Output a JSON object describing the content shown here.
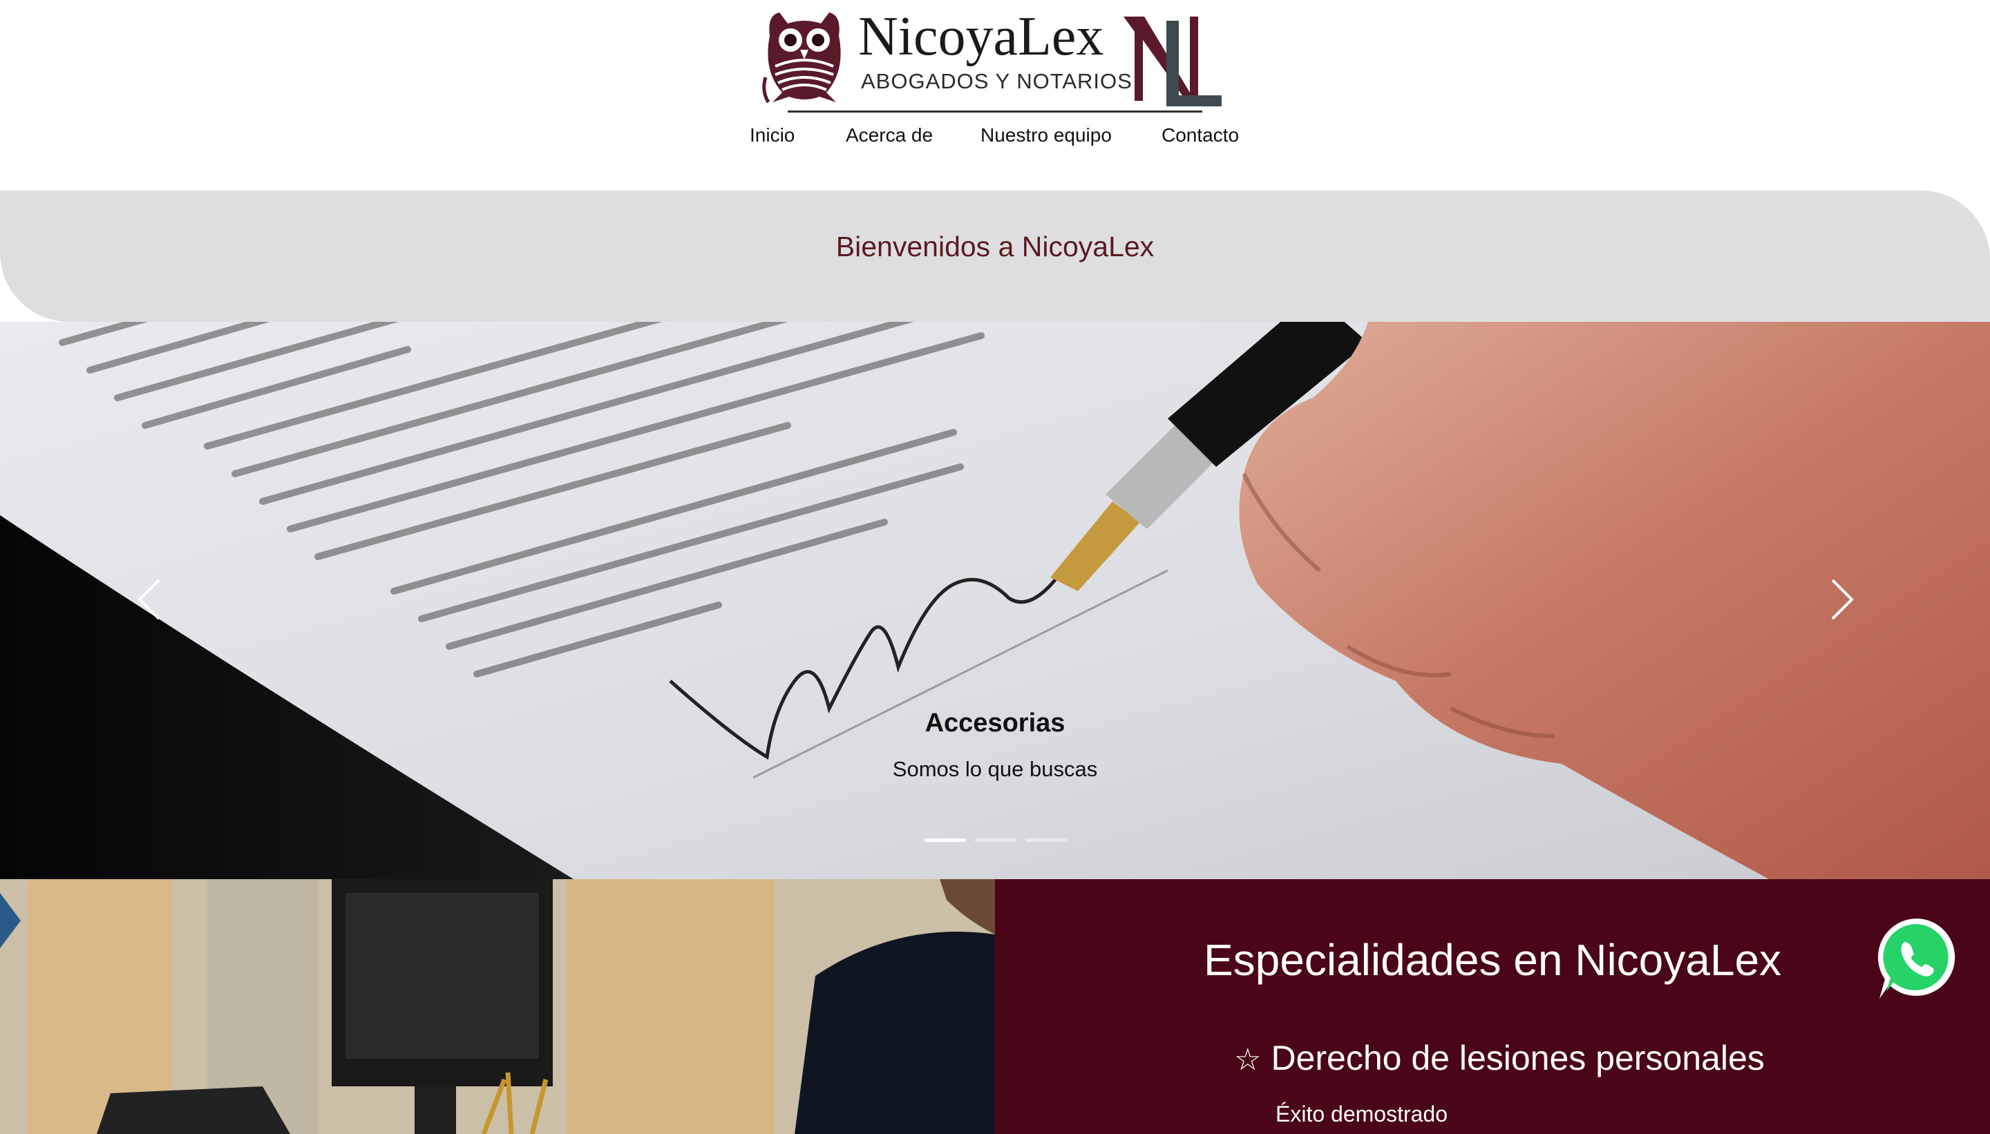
{
  "brand": {
    "name": "NicoyaLex",
    "tagline": "ABOGADOS Y NOTARIOS",
    "monogram": "NL",
    "colors": {
      "maroon": "#5a1a2a",
      "slate": "#3f4a4f"
    }
  },
  "nav": {
    "items": [
      {
        "label": "Inicio"
      },
      {
        "label": "Acerca de"
      },
      {
        "label": "Nuestro equipo"
      },
      {
        "label": "Contacto"
      }
    ]
  },
  "welcome": {
    "title": "Bienvenidos a NicoyaLex"
  },
  "carousel": {
    "title": "Accesorias",
    "subtitle": "Somos lo que buscas",
    "slide_count": 3,
    "active_index": 0,
    "prev_icon": "chevron-left-icon",
    "next_icon": "chevron-right-icon"
  },
  "specialties": {
    "title": "Especialidades en NicoyaLex",
    "items": [
      {
        "icon": "star-outline-icon",
        "label": "Derecho de lesiones personales",
        "description": "Éxito demostrado"
      }
    ],
    "background": "#4a0616"
  },
  "whatsapp": {
    "icon": "whatsapp-icon",
    "color": "#25d366"
  }
}
